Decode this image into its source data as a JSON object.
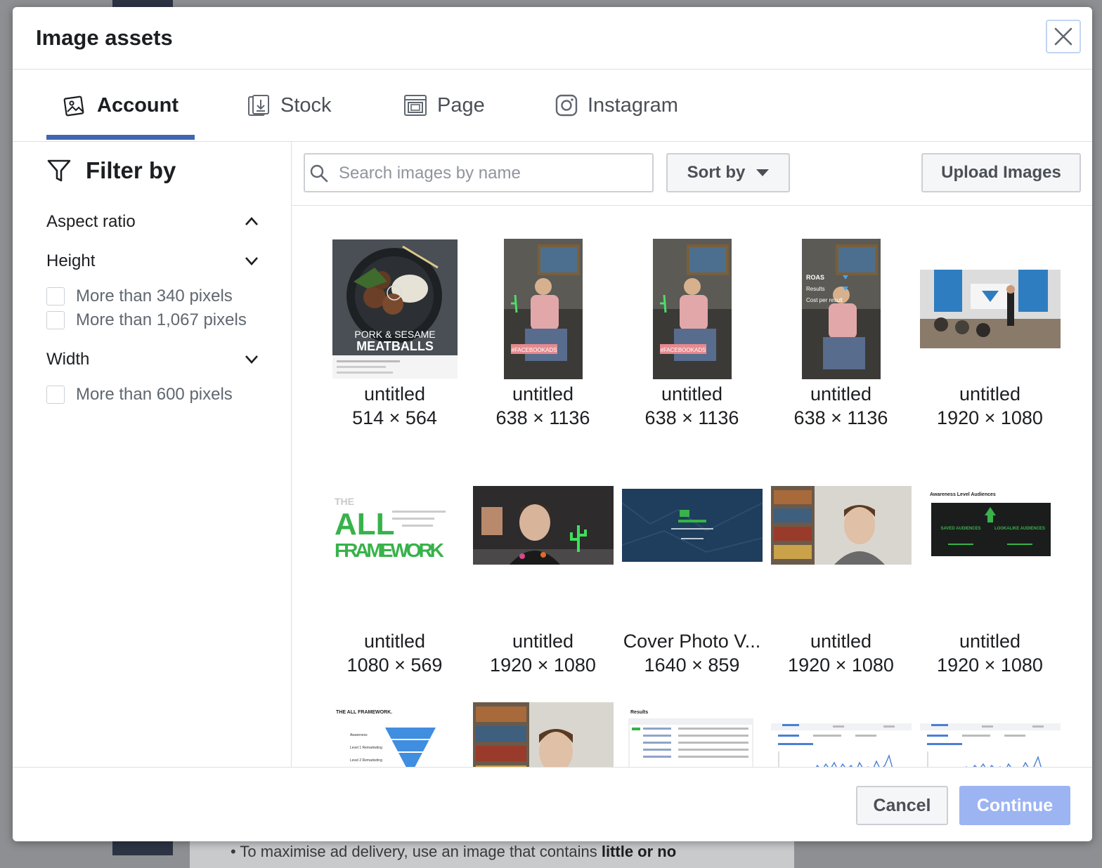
{
  "background": {
    "text_before": "To maximise ad delivery, use an image that contains ",
    "text_bold": "little or no"
  },
  "modal": {
    "title": "Image assets",
    "close_label": "Close"
  },
  "tabs": [
    {
      "label": "Account",
      "icon": "account-images-icon",
      "active": true
    },
    {
      "label": "Stock",
      "icon": "stock-images-icon",
      "active": false
    },
    {
      "label": "Page",
      "icon": "page-images-icon",
      "active": false
    },
    {
      "label": "Instagram",
      "icon": "instagram-icon",
      "active": false
    }
  ],
  "sidebar": {
    "filter_title": "Filter by",
    "sections": [
      {
        "label": "Aspect ratio",
        "expanded": true,
        "options": []
      },
      {
        "label": "Height",
        "expanded": false,
        "options": [
          "More than 340 pixels",
          "More than 1,067 pixels"
        ]
      },
      {
        "label": "Width",
        "expanded": false,
        "options": [
          "More than 600 pixels"
        ]
      }
    ]
  },
  "toolbar": {
    "search_placeholder": "Search images by name",
    "search_value": "",
    "sort_label": "Sort by",
    "upload_label": "Upload Images"
  },
  "images": [
    {
      "name": "untitled",
      "dims": "514 × 564",
      "thumb": "pork-sesame-meatballs"
    },
    {
      "name": "untitled",
      "dims": "638 × 1136",
      "thumb": "man-at-desk"
    },
    {
      "name": "untitled",
      "dims": "638 × 1136",
      "thumb": "man-at-desk"
    },
    {
      "name": "untitled",
      "dims": "638 × 1136",
      "thumb": "man-at-desk-roas"
    },
    {
      "name": "untitled",
      "dims": "1920 × 1080",
      "thumb": "presentation-room"
    },
    {
      "name": "untitled",
      "dims": "1080 × 569",
      "thumb": "all-framework-logo"
    },
    {
      "name": "untitled",
      "dims": "1920 × 1080",
      "thumb": "man-neon-cactus"
    },
    {
      "name": "Cover Photo V...",
      "dims": "1640 × 859",
      "thumb": "blue-cover-photo"
    },
    {
      "name": "untitled",
      "dims": "1920 × 1080",
      "thumb": "man-bookshelf"
    },
    {
      "name": "untitled",
      "dims": "1920 × 1080",
      "thumb": "audiences-slide"
    },
    {
      "name": "",
      "dims": "",
      "thumb": "funnel-diagram"
    },
    {
      "name": "",
      "dims": "",
      "thumb": "man-bookshelf"
    },
    {
      "name": "",
      "dims": "",
      "thumb": "results-table"
    },
    {
      "name": "",
      "dims": "",
      "thumb": "analytics-chart"
    },
    {
      "name": "",
      "dims": "",
      "thumb": "analytics-chart"
    }
  ],
  "thumb_text": {
    "meatballs_line1": "PORK & SESAME",
    "meatballs_line2": "MEATBALLS",
    "hashtag": "#FACEBOOKADS",
    "roas_line1": "ROAS",
    "roas_line2": "Results",
    "roas_line3": "Cost per result",
    "framework_the": "THE",
    "framework_all": "ALL",
    "framework_word": "FRAMEWORK",
    "audiences_title": "Awareness Level Audiences",
    "saved_audiences": "SAVED AUDIENCES",
    "lookalike_audiences": "LOOKALIKE AUDIENCES",
    "funnel_title": "THE ALL FRAMEWORK.",
    "funnel_l1": "Awareness",
    "funnel_l2": "Level 1 Remarketing",
    "funnel_l3": "Level 2 Remarketing",
    "results_title": "Results"
  },
  "footer": {
    "cancel_label": "Cancel",
    "continue_label": "Continue"
  },
  "colors": {
    "accent": "#4267b2",
    "continue_disabled": "#9cb4f2",
    "overlay": "#8e8f92"
  }
}
